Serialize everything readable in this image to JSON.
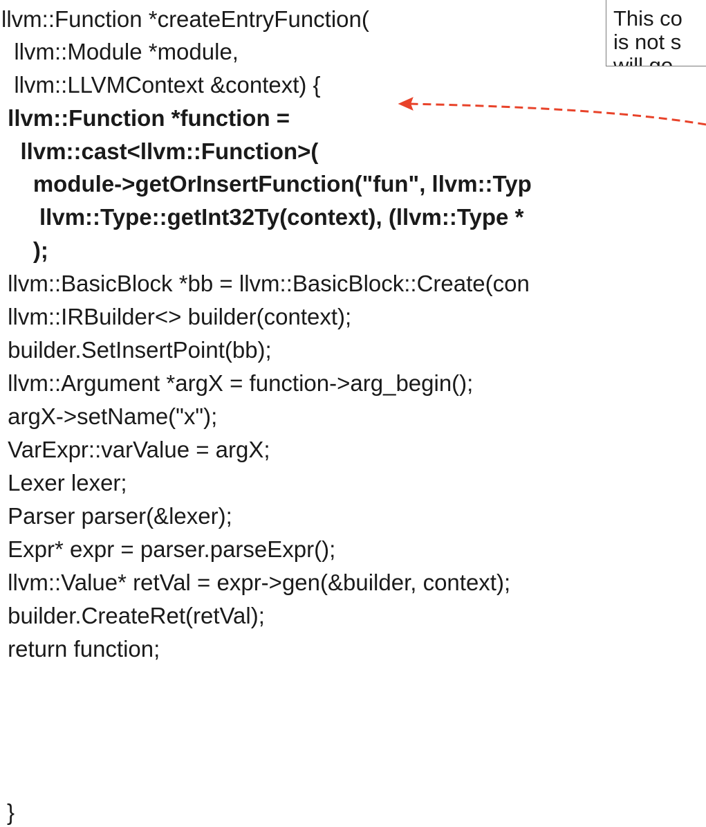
{
  "code_lines": [
    "llvm::Function *createEntryFunction(",
    "  llvm::Module *module,",
    "  llvm::LLVMContext &context) {",
    " llvm::Function *function =",
    "   llvm::cast<llvm::Function>(",
    "     module->getOrInsertFunction(\"fun\", llvm::Typ",
    "      llvm::Type::getInt32Ty(context), (llvm::Type *",
    "     );",
    " llvm::BasicBlock *bb = llvm::BasicBlock::Create(con",
    " llvm::IRBuilder<> builder(context);",
    " builder.SetInsertPoint(bb);",
    " llvm::Argument *argX = function->arg_begin();",
    " argX->setName(\"x\");",
    " VarExpr::varValue = argX;",
    " Lexer lexer;",
    " Parser parser(&lexer);",
    " Expr* expr = parser.parseExpr();",
    " llvm::Value* retVal = expr->gen(&builder, context);",
    " builder.CreateRet(retVal);",
    " return function;",
    "}"
  ],
  "callout": {
    "lines": [
      "This co",
      "is not s",
      "will go"
    ],
    "border_color": "#7a7a7a"
  },
  "arrow": {
    "color": "#e8432a",
    "style": "dashed"
  }
}
